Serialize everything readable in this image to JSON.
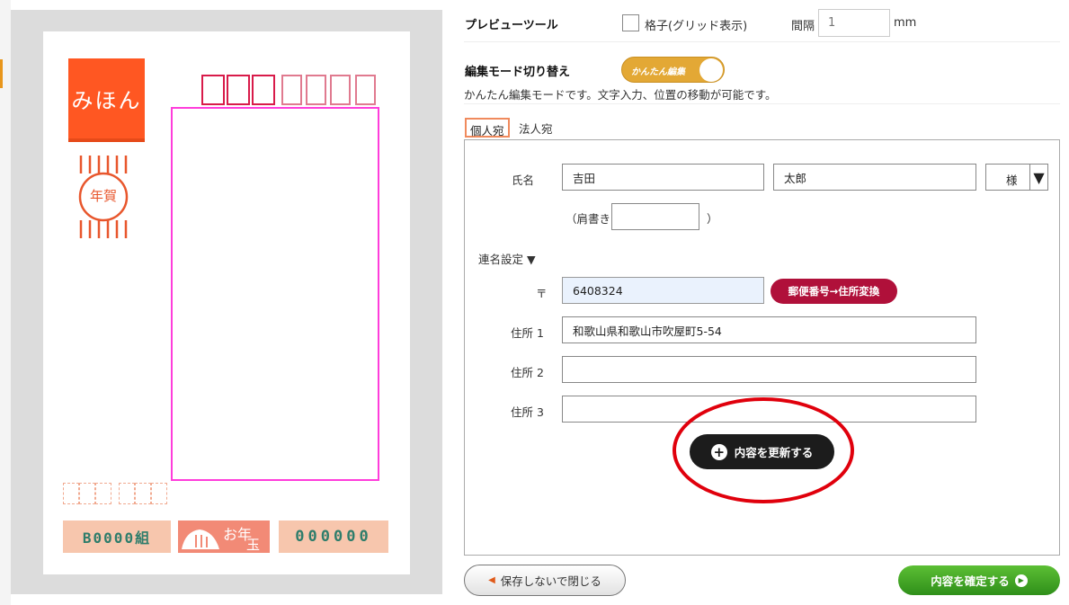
{
  "preview": {
    "brand_text": "みほん",
    "stamp_text": "年賀",
    "lot_left": "B0000組",
    "otoshidama_text": "お年",
    "otoshidama_sub": "玉",
    "lot_right": "000000"
  },
  "tools": {
    "title": "プレビューツール",
    "grid_label": "格子(グリッド表示)",
    "grid_checked": false,
    "spacing_label": "間隔",
    "spacing_placeholder": "1",
    "spacing_unit": "mm"
  },
  "mode": {
    "title": "編集モード切り替え",
    "toggle_label": "かんたん編集",
    "toggle_on": true,
    "description": "かんたん編集モードです。文字入力、位置の移動が可能です。"
  },
  "tabs": [
    {
      "label": "個人宛",
      "active": true
    },
    {
      "label": "法人宛",
      "active": false
    }
  ],
  "form": {
    "name_label": "氏名",
    "last_name": "吉田",
    "first_name": "太郎",
    "honorific": "様",
    "honorific_arrow": "▼",
    "title_open": "（肩書き",
    "title_close": "）",
    "title_value": "",
    "joint_name_label": "連名設定 ▼",
    "zip_label": "〒",
    "zip_value": "6408324",
    "convert_button": "郵便番号→住所変換",
    "address1_label": "住所 1",
    "address1_value": "和歌山県和歌山市吹屋町5-54",
    "address2_label": "住所 2",
    "address2_value": "",
    "address3_label": "住所 3",
    "address3_value": "",
    "update_button": "内容を更新する"
  },
  "footer": {
    "close_button": "保存しないで閉じる",
    "confirm_button": "内容を確定する"
  },
  "colors": {
    "accent_toggle": "#e3a835",
    "convert_button": "#b0103a",
    "confirm_button": "#3fa52a",
    "highlight_ring": "#e0000c",
    "address_frame": "#ff3ddb"
  }
}
